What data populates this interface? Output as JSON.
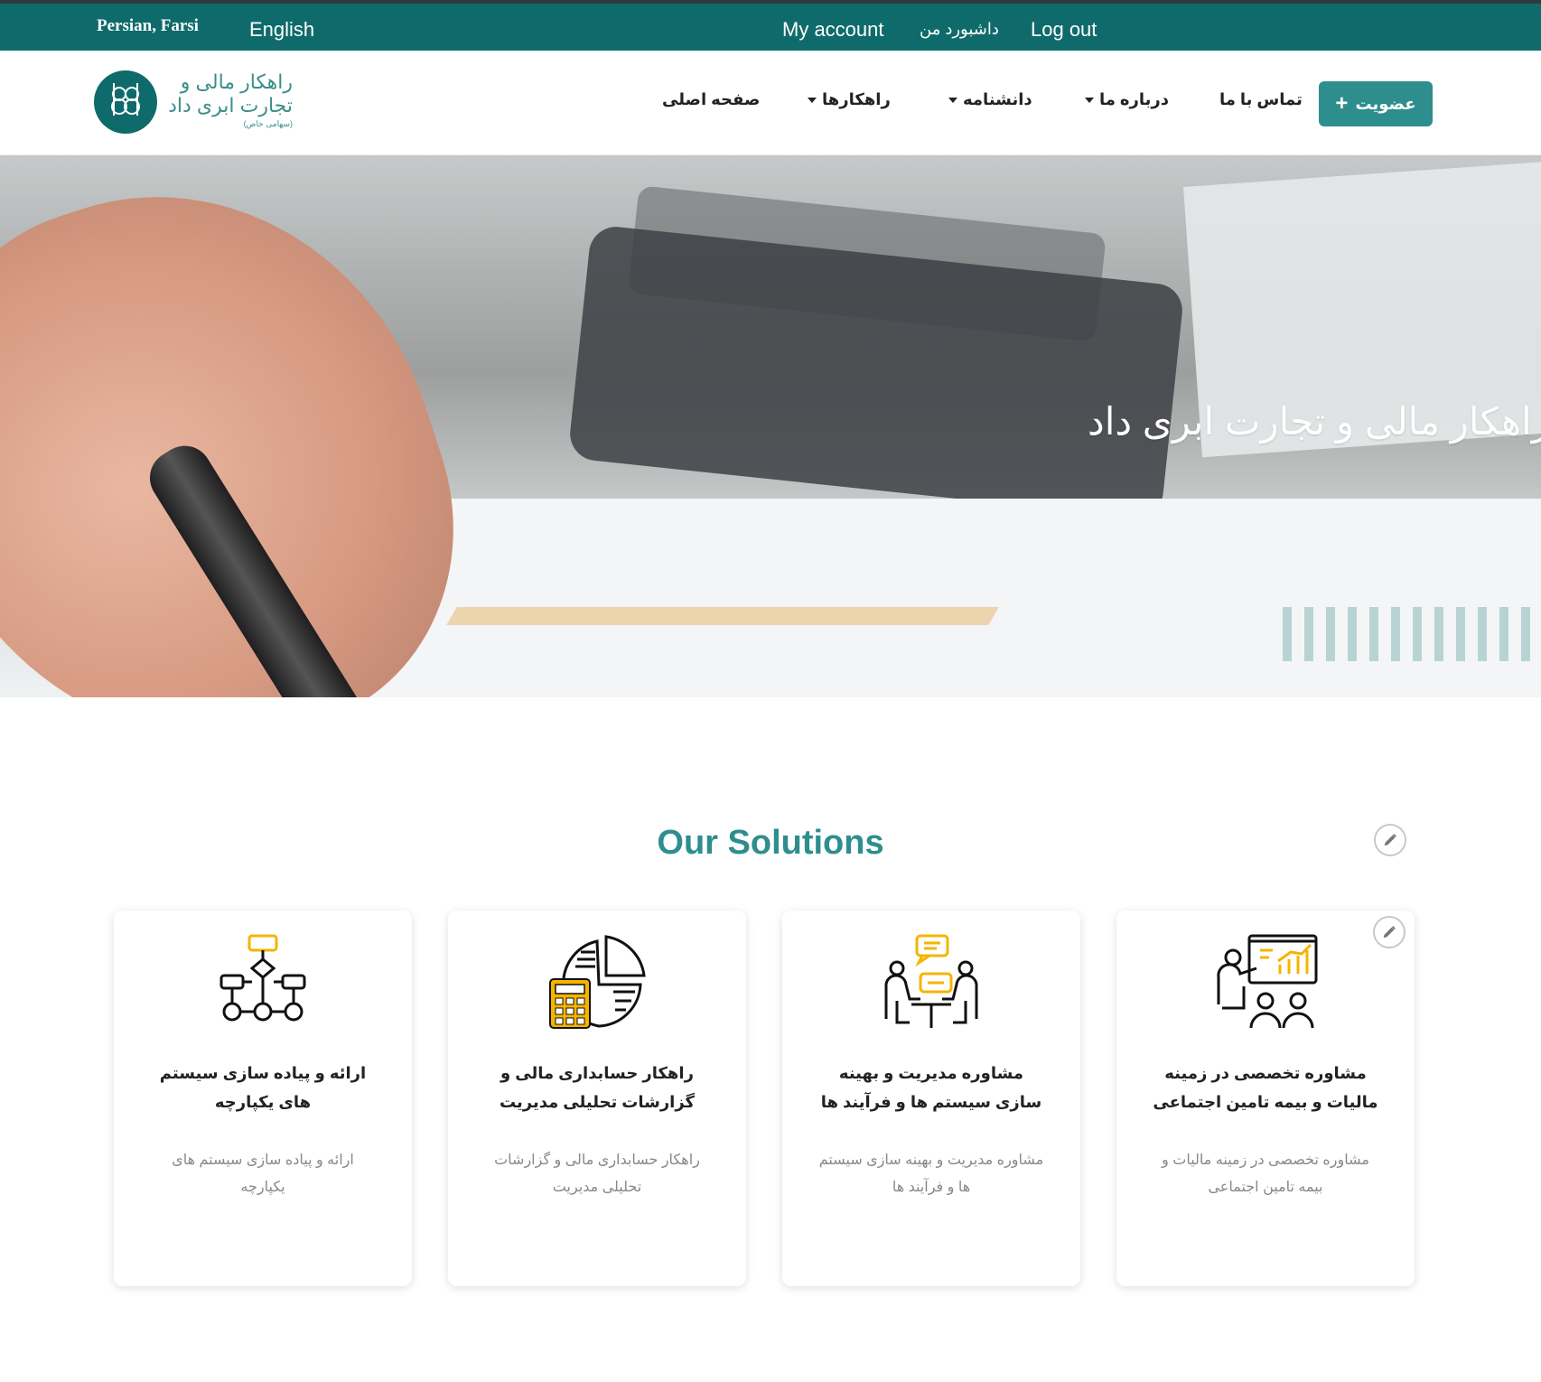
{
  "topbar": {
    "lang_fa": "Persian, Farsi",
    "lang_en": "English",
    "my_account": "My account",
    "dashboard": "داشبورد من",
    "logout": "Log out"
  },
  "logo": {
    "line1": "راهکار مالی و",
    "line2": "تجارت ابری داد",
    "line3": "(سهامی خاص)"
  },
  "nav": {
    "home": "صفحه اصلی",
    "solutions": "راهکارها",
    "knowledge": "دانشنامه",
    "about": "درباره ما",
    "contact": "تماس با ما",
    "join": "عضویت",
    "join_icon": "plus-icon"
  },
  "hero": {
    "title": "راهکار مالی و تجارت ابری داد"
  },
  "section": {
    "title": "Our Solutions"
  },
  "cards": [
    {
      "title": "ارائه و پیاده سازی سیستم های یکپارچه",
      "desc": "ارائه و پیاده سازی سیستم های یکپارچه",
      "icon": "flowchart-icon"
    },
    {
      "title": "راهکار حسابداری مالی و گزارشات تحلیلی مدیریت",
      "desc": "راهکار حسابداری مالی و گزارشات تحلیلی مدیریت",
      "icon": "calculator-pie-chart-icon"
    },
    {
      "title": "مشاوره مدیریت و بهینه سازی سیستم ها و فرآیند ها",
      "desc": "مشاوره مدیریت و بهینه سازی سیستم ها و فرآیند ها",
      "icon": "consulting-meeting-icon"
    },
    {
      "title": "مشاوره تخصصی در زمینه مالیات و بیمه تامین اجتماعی",
      "desc": "مشاوره تخصصی در زمینه مالیات و بیمه تامین اجتماعی",
      "icon": "presentation-icon"
    }
  ],
  "colors": {
    "brand": "#0f6b6b",
    "accent": "#2e8e8e",
    "icon_highlight": "#f5b400"
  }
}
